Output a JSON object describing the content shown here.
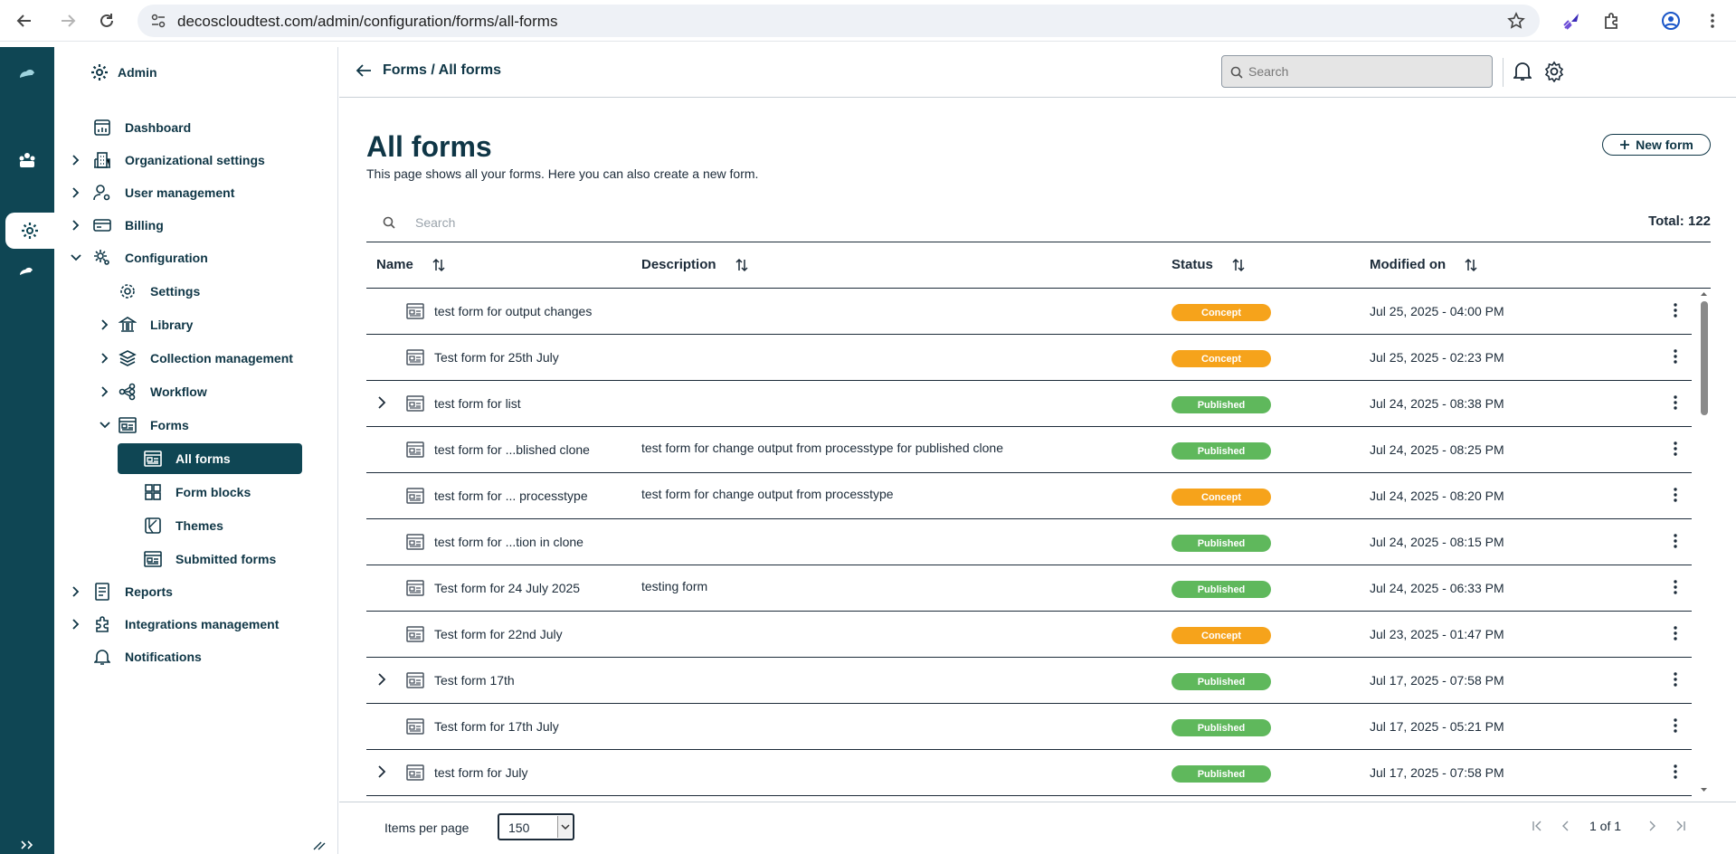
{
  "browser": {
    "url": "decoscloudtest.com/admin/configuration/forms/all-forms"
  },
  "sidebar": {
    "header": "Admin",
    "items": [
      {
        "label": "Dashboard"
      },
      {
        "label": "Organizational settings"
      },
      {
        "label": "User management"
      },
      {
        "label": "Billing"
      },
      {
        "label": "Configuration"
      },
      {
        "label": "Settings"
      },
      {
        "label": "Library"
      },
      {
        "label": "Collection management"
      },
      {
        "label": "Workflow"
      },
      {
        "label": "Forms"
      },
      {
        "label": "All forms"
      },
      {
        "label": "Form blocks"
      },
      {
        "label": "Themes"
      },
      {
        "label": "Submitted forms"
      },
      {
        "label": "Reports"
      },
      {
        "label": "Integrations management"
      },
      {
        "label": "Notifications"
      }
    ]
  },
  "header": {
    "breadcrumb": "Forms / All forms",
    "search_placeholder": "Search"
  },
  "page": {
    "title": "All forms",
    "subtitle": "This page shows all your forms. Here you can also create a new form.",
    "new_button": "New form",
    "search_placeholder": "Search",
    "total": "Total: 122"
  },
  "table": {
    "columns": [
      "Name",
      "Description",
      "Status",
      "Modified on"
    ],
    "rows": [
      {
        "name": "test form for output changes",
        "description": "",
        "status": "Concept",
        "modified": "Jul 25, 2025 - 04:00 PM",
        "expandable": false
      },
      {
        "name": "Test form for 25th July",
        "description": "",
        "status": "Concept",
        "modified": "Jul 25, 2025 - 02:23 PM",
        "expandable": false
      },
      {
        "name": "test form for list",
        "description": "",
        "status": "Published",
        "modified": "Jul 24, 2025 - 08:38 PM",
        "expandable": true
      },
      {
        "name": "test form for ...blished clone",
        "description": "test form for change output from processtype for published clone",
        "status": "Published",
        "modified": "Jul 24, 2025 - 08:25 PM",
        "expandable": false
      },
      {
        "name": "test form for ... processtype",
        "description": "test form for change output from processtype",
        "status": "Concept",
        "modified": "Jul 24, 2025 - 08:20 PM",
        "expandable": false
      },
      {
        "name": "test form for ...tion in clone",
        "description": "",
        "status": "Published",
        "modified": "Jul 24, 2025 - 08:15 PM",
        "expandable": false
      },
      {
        "name": "Test form for 24 July 2025",
        "description": "testing form",
        "status": "Published",
        "modified": "Jul 24, 2025 - 06:33 PM",
        "expandable": false
      },
      {
        "name": "Test form for 22nd July",
        "description": "",
        "status": "Concept",
        "modified": "Jul 23, 2025 - 01:47 PM",
        "expandable": false
      },
      {
        "name": "Test form 17th",
        "description": "",
        "status": "Published",
        "modified": "Jul 17, 2025 - 07:58 PM",
        "expandable": true
      },
      {
        "name": "Test form for 17th July",
        "description": "",
        "status": "Published",
        "modified": "Jul 17, 2025 - 05:21 PM",
        "expandable": false
      },
      {
        "name": "test form for July",
        "description": "",
        "status": "Published",
        "modified": "Jul 17, 2025 - 07:58 PM",
        "expandable": true
      }
    ]
  },
  "status_colors": {
    "Concept": "#f6a31b",
    "Published": "#5fb85c"
  },
  "footer": {
    "items_per_page_label": "Items per page",
    "items_per_page_value": "150",
    "page_info": "1 of 1"
  },
  "colors": {
    "brand": "#0f4654",
    "text": "#1c2b39"
  }
}
